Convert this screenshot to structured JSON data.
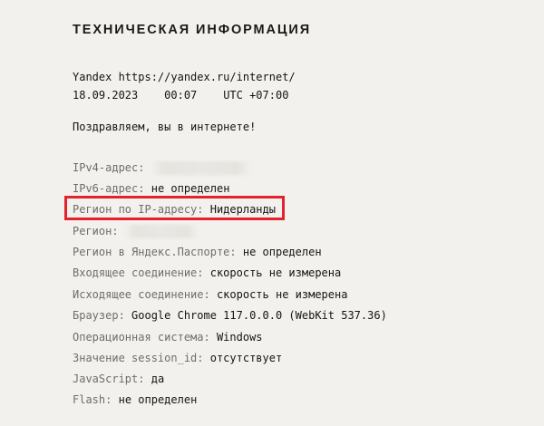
{
  "page": {
    "title": "ТЕХНИЧЕСКАЯ ИНФОРМАЦИЯ",
    "site_line": "Yandex https://yandex.ru/internet/",
    "date": "18.09.2023",
    "time": "00:07",
    "timezone": "UTC +07:00",
    "greeting": "Поздравляем, вы в интернете!"
  },
  "rows": [
    {
      "label": "IPv4-адрес:",
      "value": "",
      "hidden": true
    },
    {
      "label": "IPv6-адрес:",
      "value": "не определен"
    },
    {
      "label": "Регион по IP-адресу:",
      "value": "Нидерланды",
      "highlighted": true
    },
    {
      "label": "Регион:",
      "value": "",
      "hidden": true
    },
    {
      "label": "Регион в Яндекс.Паспорте:",
      "value": "не определен"
    },
    {
      "label": "Входящее соединение:",
      "value": "скорость не измерена"
    },
    {
      "label": "Исходящее соединение:",
      "value": "скорость не измерена"
    },
    {
      "label": "Браузер:",
      "value": "Google Chrome 117.0.0.0 (WebKit 537.36)"
    },
    {
      "label": "Операционная система:",
      "value": "Windows"
    },
    {
      "label": "Значение session_id:",
      "value": "отсутствует"
    },
    {
      "label": "JavaScript:",
      "value": "да"
    },
    {
      "label": "Flash:",
      "value": "не определен"
    }
  ],
  "colors": {
    "background": "#f2f1ed",
    "label": "#6e6e6e",
    "value": "#141414",
    "highlight_border": "#e3232b"
  }
}
